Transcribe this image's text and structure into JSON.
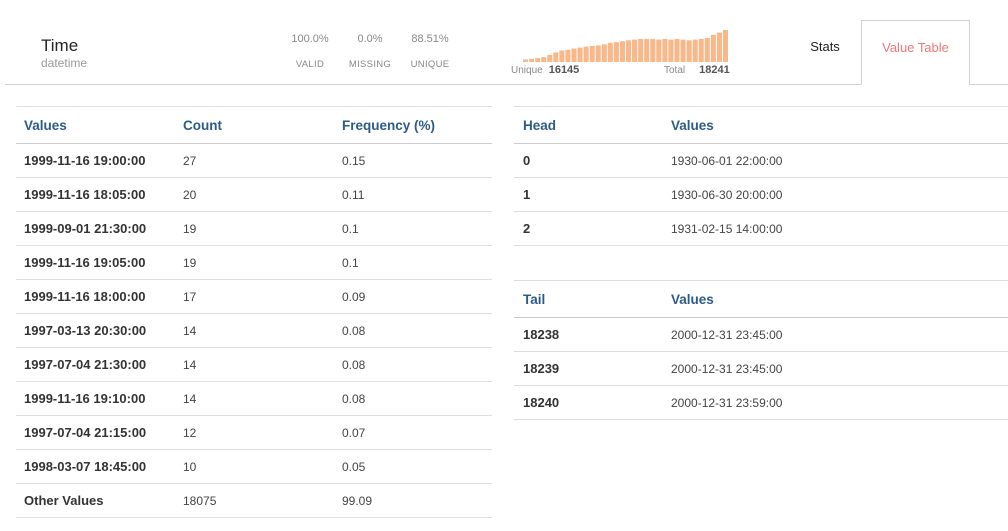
{
  "column": {
    "name": "Time",
    "type": "datetime"
  },
  "stats": [
    {
      "value": "100.0%",
      "label": "VALID"
    },
    {
      "value": "0.0%",
      "label": "MISSING"
    },
    {
      "value": "88.51%",
      "label": "UNIQUE"
    }
  ],
  "histogram": {
    "unique_label": "Unique",
    "unique_value": "16145",
    "total_label": "Total",
    "total_value": "18241",
    "bars": [
      0.08,
      0.1,
      0.12,
      0.15,
      0.22,
      0.3,
      0.36,
      0.38,
      0.42,
      0.45,
      0.48,
      0.5,
      0.52,
      0.55,
      0.6,
      0.62,
      0.65,
      0.68,
      0.7,
      0.72,
      0.72,
      0.72,
      0.7,
      0.72,
      0.7,
      0.72,
      0.7,
      0.68,
      0.7,
      0.72,
      0.75,
      0.85,
      0.92,
      1.0
    ],
    "color": "#f9b88a"
  },
  "tabs": {
    "stats": "Stats",
    "value_table": "Value Table"
  },
  "freq_table": {
    "headers": [
      "Values",
      "Count",
      "Frequency (%)"
    ],
    "rows": [
      [
        "1999-11-16 19:00:00",
        "27",
        "0.15"
      ],
      [
        "1999-11-16 18:05:00",
        "20",
        "0.11"
      ],
      [
        "1999-09-01 21:30:00",
        "19",
        "0.1"
      ],
      [
        "1999-11-16 19:05:00",
        "19",
        "0.1"
      ],
      [
        "1999-11-16 18:00:00",
        "17",
        "0.09"
      ],
      [
        "1997-03-13 20:30:00",
        "14",
        "0.08"
      ],
      [
        "1997-07-04 21:30:00",
        "14",
        "0.08"
      ],
      [
        "1999-11-16 19:10:00",
        "14",
        "0.08"
      ],
      [
        "1997-07-04 21:15:00",
        "12",
        "0.07"
      ],
      [
        "1998-03-07 18:45:00",
        "10",
        "0.05"
      ],
      [
        "Other Values",
        "18075",
        "99.09"
      ]
    ]
  },
  "head_table": {
    "headers": [
      "Head",
      "Values"
    ],
    "rows": [
      [
        "0",
        "1930-06-01 22:00:00"
      ],
      [
        "1",
        "1930-06-30 20:00:00"
      ],
      [
        "2",
        "1931-02-15 14:00:00"
      ]
    ]
  },
  "tail_table": {
    "headers": [
      "Tail",
      "Values"
    ],
    "rows": [
      [
        "18238",
        "2000-12-31 23:45:00"
      ],
      [
        "18239",
        "2000-12-31 23:45:00"
      ],
      [
        "18240",
        "2000-12-31 23:59:00"
      ]
    ]
  }
}
